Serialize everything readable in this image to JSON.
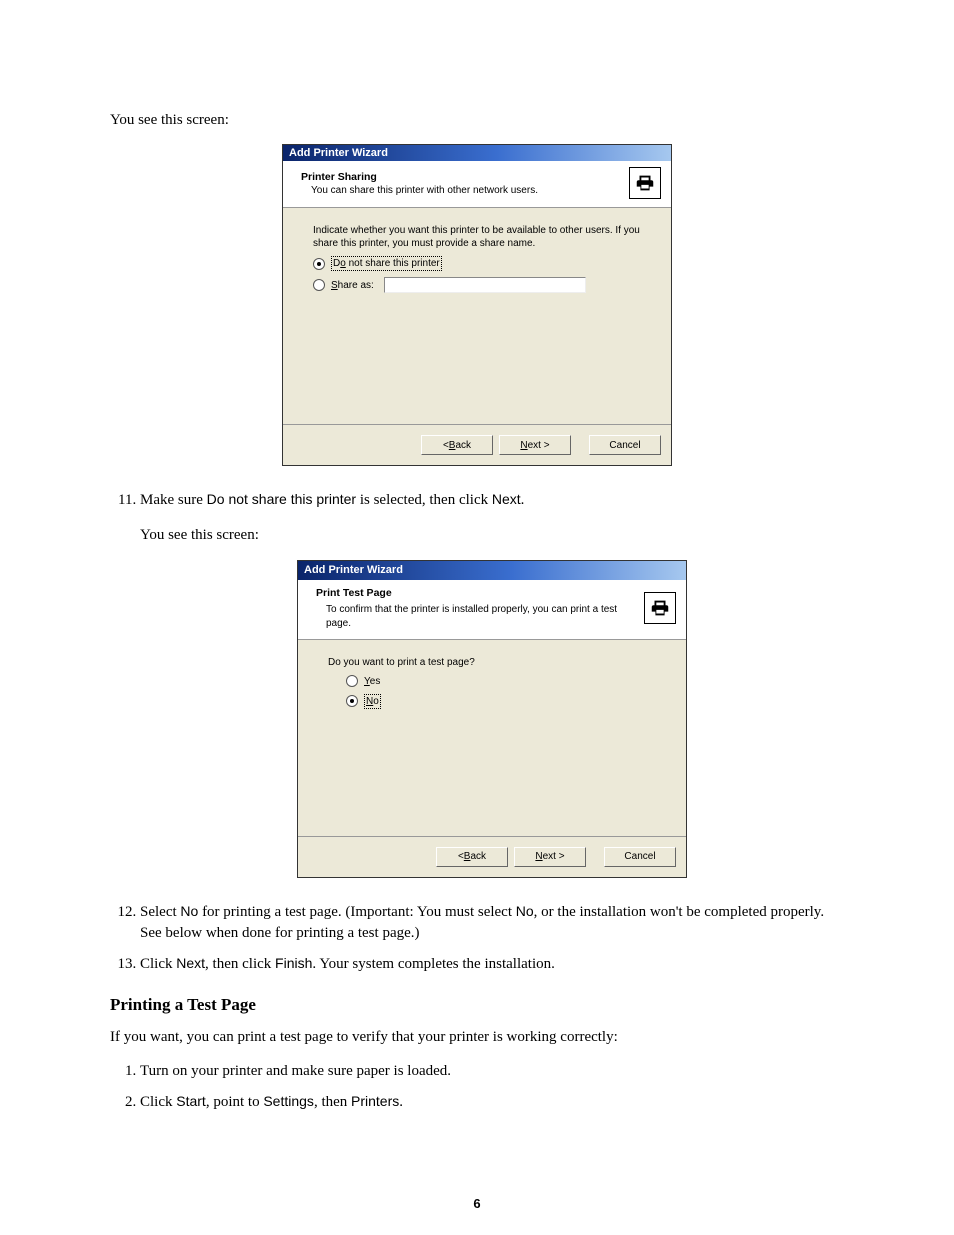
{
  "intro1": "You see this screen:",
  "wizard1": {
    "title": "Add Printer Wizard",
    "header_title": "Printer Sharing",
    "header_sub": "You can share this printer with other network users.",
    "body_text": "Indicate whether you want this printer to be available to other users. If you share this printer, you must provide a share name.",
    "option_no_share_pre": "D",
    "option_no_share_u": "o",
    "option_no_share_post": " not share this printer",
    "option_share_u": "S",
    "option_share_post": "hare as:",
    "back_pre": "< ",
    "back_u": "B",
    "back_post": "ack",
    "next_u": "N",
    "next_post": "ext >",
    "cancel": "Cancel"
  },
  "step11_pre": "Make sure ",
  "step11_bold1": "Do not share this printer",
  "step11_mid": " is selected, then click ",
  "step11_bold2": "Next",
  "step11_post": ".",
  "intro2": "You see this screen:",
  "wizard2": {
    "title": "Add Printer Wizard",
    "header_title": "Print Test Page",
    "header_sub": "To confirm that the printer is installed properly, you can print a test page.",
    "body_text": "Do you want to print a test page?",
    "yes_u": "Y",
    "yes_post": "es",
    "no_u": "N",
    "no_post": "o",
    "back_pre": "< ",
    "back_u": "B",
    "back_post": "ack",
    "next_u": "N",
    "next_post": "ext >",
    "cancel": "Cancel"
  },
  "step12_pre": "Select ",
  "step12_bold1": "No",
  "step12_mid1": " for printing a test page. (Important: You must select ",
  "step12_bold2": "No",
  "step12_mid2": ", or the installation won't be completed properly. See below when done for printing a test page.)",
  "step13_pre": "Click ",
  "step13_bold1": "Next",
  "step13_mid": ", then click ",
  "step13_bold2": "Finish",
  "step13_post": ". Your system completes the installation.",
  "section_title": "Printing a Test Page",
  "test_intro": "If you want, you can print a test page to verify that your printer is working correctly:",
  "test_step1": "Turn on your printer and make sure paper is loaded.",
  "test_step2_pre": "Click ",
  "test_step2_b1": "Start",
  "test_step2_m1": ", point to ",
  "test_step2_b2": "Settings",
  "test_step2_m2": ", then ",
  "test_step2_b3": "Printers",
  "test_step2_post": ".",
  "page_number": "6"
}
